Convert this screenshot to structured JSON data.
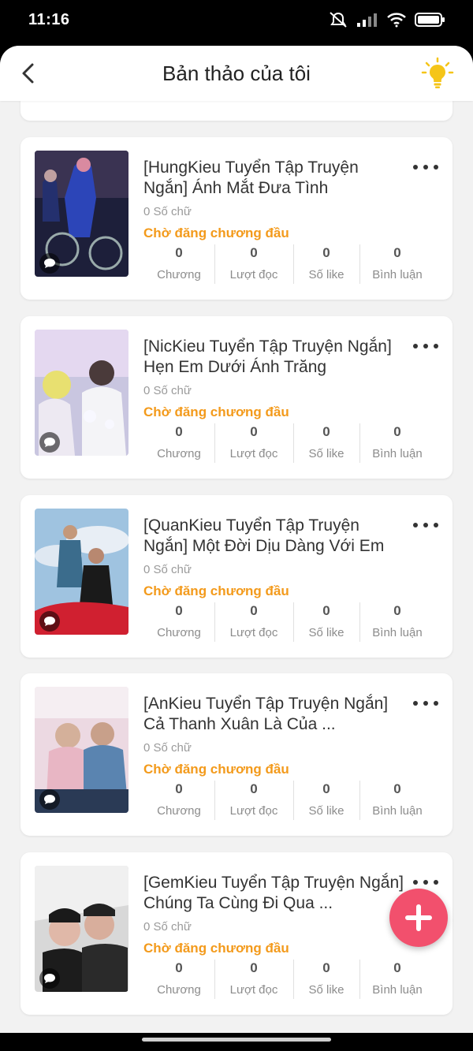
{
  "status_bar": {
    "time": "11:16"
  },
  "header": {
    "title": "Bản thảo của tôi"
  },
  "stat_labels": {
    "chapters": "Chương",
    "reads": "Lượt đọc",
    "likes": "Số like",
    "comments": "Bình luận"
  },
  "stories": [
    {
      "title": "[HungKieu Tuyển Tập Truyện Ngắn] Ánh Mắt Đưa Tình",
      "word_count": "0 Số chữ",
      "status": "Chờ đăng chương đầu",
      "chapters": "0",
      "reads": "0",
      "likes": "0",
      "comments": "0"
    },
    {
      "title": "[NicKieu Tuyển Tập Truyện Ngắn] Hẹn Em Dưới Ánh Trăng",
      "word_count": "0 Số chữ",
      "status": "Chờ đăng chương đầu",
      "chapters": "0",
      "reads": "0",
      "likes": "0",
      "comments": "0"
    },
    {
      "title": "[QuanKieu Tuyển Tập Truyện Ngắn] Một Đời Dịu Dàng Với Em",
      "word_count": "0 Số chữ",
      "status": "Chờ đăng chương đầu",
      "chapters": "0",
      "reads": "0",
      "likes": "0",
      "comments": "0"
    },
    {
      "title": "[AnKieu Tuyển Tập Truyện Ngắn] Cả Thanh Xuân Là Của ...",
      "word_count": "0 Số chữ",
      "status": "Chờ đăng chương đầu",
      "chapters": "0",
      "reads": "0",
      "likes": "0",
      "comments": "0"
    },
    {
      "title": "[GemKieu Tuyển Tập Truyện Ngắn] Chúng Ta Cùng Đi Qua ...",
      "word_count": "0 Số chữ",
      "status": "Chờ đăng chương đầu",
      "chapters": "0",
      "reads": "0",
      "likes": "0",
      "comments": "0"
    }
  ],
  "colors": {
    "accent_orange": "#f39a1b",
    "fab_pink": "#f2506d",
    "bulb_yellow": "#f5c518"
  },
  "icons": {
    "back": "chevron-left-icon",
    "tip": "lightbulb-icon",
    "more": "more-horizontal-icon",
    "add": "plus-icon",
    "comment": "comment-bubble-icon"
  }
}
